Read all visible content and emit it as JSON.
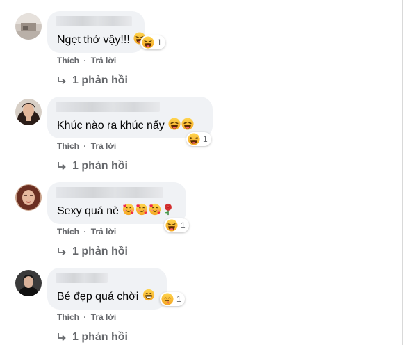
{
  "colors": {
    "bubble": "#f0f2f5",
    "meta_text": "#65676b",
    "text": "#050505"
  },
  "comments": [
    {
      "text": "Ngẹt thở vậy!!!",
      "emojis": [
        "laugh"
      ],
      "reaction": {
        "icon": "haha-icon",
        "count": "1"
      },
      "actions": {
        "like": "Thích",
        "sep": "·",
        "reply": "Trả lời"
      },
      "replies": "1 phản hồi"
    },
    {
      "text": "Khúc nào ra khúc nấy",
      "emojis": [
        "laugh",
        "laugh"
      ],
      "reaction": {
        "icon": "haha-icon",
        "count": "1"
      },
      "actions": {
        "like": "Thích",
        "sep": "·",
        "reply": "Trả lời"
      },
      "replies": "1 phản hồi"
    },
    {
      "text": "Sexy quá nè",
      "emojis": [
        "hearts",
        "hearts",
        "hearts",
        "rose"
      ],
      "reaction": {
        "icon": "haha-icon",
        "count": "1"
      },
      "actions": {
        "like": "Thích",
        "sep": "·",
        "reply": "Trả lời"
      },
      "replies": "1 phản hồi"
    },
    {
      "text": "Bé đẹp quá chời",
      "emojis": [
        "grin"
      ],
      "reaction": {
        "icon": "wow-icon",
        "count": "1"
      },
      "actions": {
        "like": "Thích",
        "sep": "·",
        "reply": "Trả lời"
      },
      "replies": "1 phản hồi"
    }
  ]
}
